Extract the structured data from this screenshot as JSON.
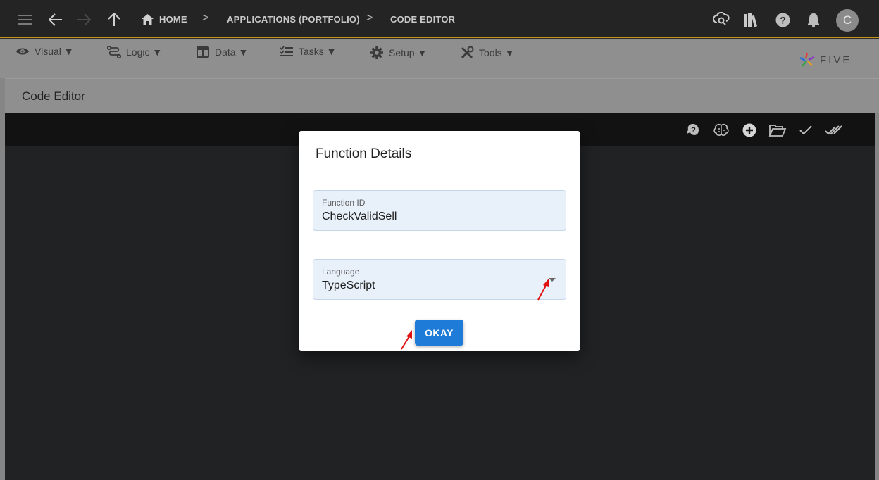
{
  "topbar": {
    "breadcrumbs": [
      "HOME",
      "APPLICATIONS (PORTFOLIO)",
      "CODE EDITOR"
    ],
    "separator": ">",
    "avatar_initial": "C",
    "icons": [
      "menu-icon",
      "back-arrow-icon",
      "forward-arrow-icon",
      "up-arrow-icon",
      "home-icon",
      "cloud-search-icon",
      "library-icon",
      "help-icon",
      "notification-bell-icon"
    ]
  },
  "menubar": {
    "items": [
      {
        "label": "Visual ▼",
        "icon": "eye-icon"
      },
      {
        "label": "Logic ▼",
        "icon": "flow-icon"
      },
      {
        "label": "Data ▼",
        "icon": "table-icon"
      },
      {
        "label": "Tasks ▼",
        "icon": "checklist-icon"
      },
      {
        "label": "Setup ▼",
        "icon": "gear-icon"
      },
      {
        "label": "Tools ▼",
        "icon": "tools-icon"
      }
    ],
    "logo_text": "FIVE"
  },
  "page": {
    "title": "Code Editor"
  },
  "editor_toolbar": {
    "icons": [
      "help-bubble-icon",
      "brain-icon",
      "add-circle-icon",
      "open-folder-icon",
      "check-icon",
      "double-check-icon"
    ]
  },
  "dialog": {
    "title": "Function Details",
    "function_id": {
      "label": "Function ID",
      "value": "CheckValidSell"
    },
    "language": {
      "label": "Language",
      "value": "TypeScript"
    },
    "okay_label": "OKAY"
  },
  "colors": {
    "topbar_bg": "#242424",
    "accent_line": "#c8931a",
    "menubar_bg": "#8f8f8f",
    "button_primary": "#1e7bd7",
    "field_bg": "#e8f0fa",
    "annotation_arrow": "#e01010"
  }
}
